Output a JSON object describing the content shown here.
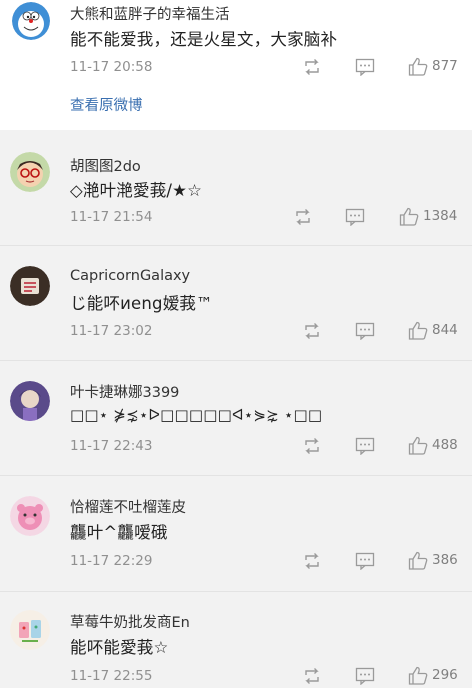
{
  "post": {
    "author": "大熊和蓝胖子的幸福生活",
    "text": "能不能爱我，还是火星文，大家脑补",
    "time": "11-17 20:58",
    "likes": "877",
    "link_text": "查看原微博"
  },
  "comments": [
    {
      "author": "胡图图2do",
      "text": "◇滟叶滟愛莪/★☆",
      "time": "11-17 21:54",
      "likes": "1384"
    },
    {
      "author": "CapricornGalaxy",
      "text": "じ能吥иeng嫒莪™",
      "time": "11-17 23:02",
      "likes": "844"
    },
    {
      "author": "叶卡捷琳娜3399",
      "text": "□□⋆ ⋡⋨⋆ᐅ□□□□□ᐊ⋆⋟⋩ ⋆□□",
      "time": "11-17 22:43",
      "likes": "488"
    },
    {
      "author": "恰榴莲不吐榴莲皮",
      "text": "龘叶^龘嗳硪",
      "time": "11-17 22:29",
      "likes": "386"
    },
    {
      "author": "草莓牛奶批发商En",
      "text": "能吥能愛莪☆",
      "time": "11-17 22:55",
      "likes": "296"
    }
  ]
}
